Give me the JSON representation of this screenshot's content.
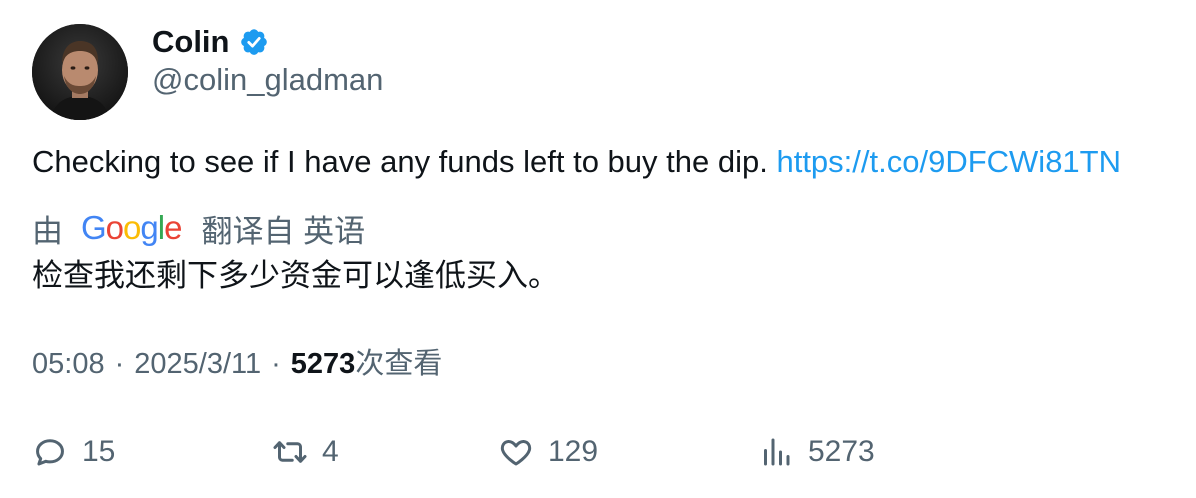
{
  "author": {
    "name": "Colin",
    "handle": "@colin_gladman"
  },
  "tweet": {
    "text": "Checking to see if I have any funds left to buy the dip.",
    "link": "https://t.co/9DFCWi81TN"
  },
  "translation": {
    "prefix": "由",
    "provider": "Google",
    "suffix": "翻译自 英语",
    "text": "检查我还剩下多少资金可以逢低买入。"
  },
  "meta": {
    "time": "05:08",
    "date": "2025/3/11",
    "views_count": "5273",
    "views_label": "次查看",
    "separator": "·"
  },
  "actions": {
    "replies": "15",
    "retweets": "4",
    "likes": "129",
    "views": "5273"
  },
  "colors": {
    "link": "#1d9bf0",
    "secondary_text": "#536471",
    "primary_text": "#0f1419",
    "verified_badge": "#1d9bf0"
  }
}
